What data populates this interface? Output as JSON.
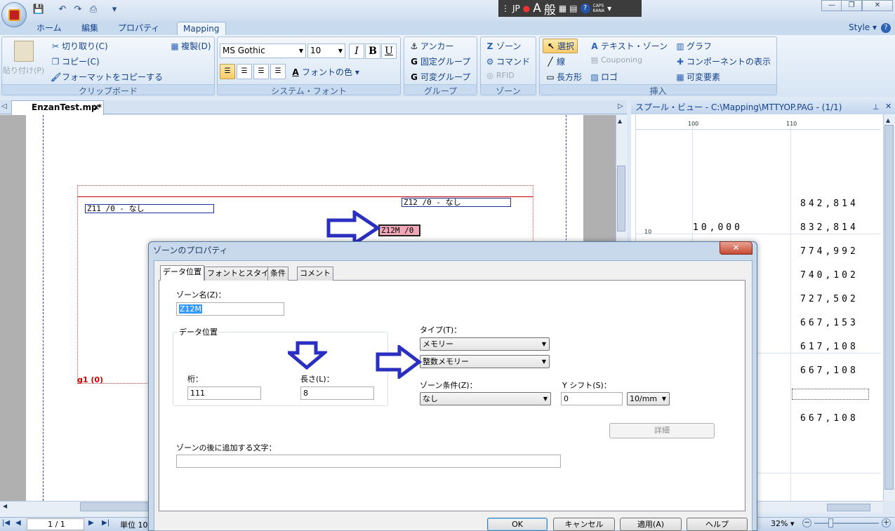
{
  "qat": {
    "save": "💾",
    "undo": "↶",
    "redo": "↷",
    "print": "⎙",
    "more": "▾"
  },
  "ime": {
    "mode": "JP",
    "font": "A",
    "kanji": "般",
    "help": "?",
    "caps": "CAPS",
    "kana": "KANA"
  },
  "ribbon_tabs": [
    "ホーム",
    "編集",
    "プロパティ",
    "Mapping"
  ],
  "style_label": "Style ▾",
  "clipboard": {
    "paste": "貼り付け(P)",
    "cut": "切り取り(C)",
    "copy": "コピー(C)",
    "format_copy": "フォーマットをコピーする",
    "duplicate": "複製(D)",
    "group": "クリップボード"
  },
  "font": {
    "family": "MS Gothic",
    "size": "10",
    "italic": "I",
    "bold": "B",
    "underline": "U",
    "font_color": "フォントの色 ▾",
    "group": "システム・フォント"
  },
  "grouping": {
    "anchor": "アンカー",
    "fixed": "固定グループ",
    "variable": "可変グループ",
    "group": "グループ"
  },
  "zone": {
    "zone": "ゾーン",
    "command": "コマンド",
    "rfid": "RFID",
    "group": "ゾーン"
  },
  "insert": {
    "select": "選択",
    "line": "線",
    "rect": "長方形",
    "text_zone": "テキスト・ゾーン",
    "couponing": "Couponing",
    "logo": "ロゴ",
    "graph": "グラフ",
    "component": "コンポーネントの表示",
    "variable_elem": "可変要素",
    "group": "挿入"
  },
  "doc_tab": "EnzanTest.mp*",
  "spool_title": "スプール・ビュー - C:\\Mapping\\MTTYOP.PAG - (1/1)",
  "canvas": {
    "z11": "Z11 /0 - なし",
    "z12": "Z12 /0 - なし",
    "z12m": "Z12M /0",
    "g1": "g1 (0)"
  },
  "spool": {
    "ruler_100": "100",
    "ruler_110": "110",
    "ruler_10": "10",
    "left_value": "10,000",
    "values": [
      "842,814",
      "832,814",
      "774,992",
      "740,102",
      "727,502",
      "667,153",
      "617,108",
      "667,108",
      "667,108"
    ]
  },
  "status": {
    "page": "1 / 1",
    "unit": "単位 10",
    "zoom": "32% ▾"
  },
  "dialog": {
    "title": "ゾーンのプロパティ",
    "tabs": [
      "データ位置",
      "フォントとスタイル",
      "条件",
      "コメント"
    ],
    "zone_name_label": "ゾーン名(Z)：",
    "zone_name": "Z12M",
    "data_pos_group": "データ位置",
    "col_label": "桁：",
    "col_value": "111",
    "len_label": "長さ(L)：",
    "len_value": "8",
    "type_label": "タイプ(T)：",
    "type_value": "メモリー",
    "subtype_value": "整数メモリー",
    "cond_label": "ゾーン条件(Z)：",
    "cond_value": "なし",
    "yshift_label": "Y シフト(S)：",
    "yshift_value": "0",
    "yshift_unit": "10/mm",
    "detail_btn": "詳細",
    "append_label": "ゾーンの後に追加する文字：",
    "append_value": "",
    "ok": "OK",
    "cancel": "キャンセル",
    "apply": "適用(A)",
    "help": "ヘルプ"
  }
}
